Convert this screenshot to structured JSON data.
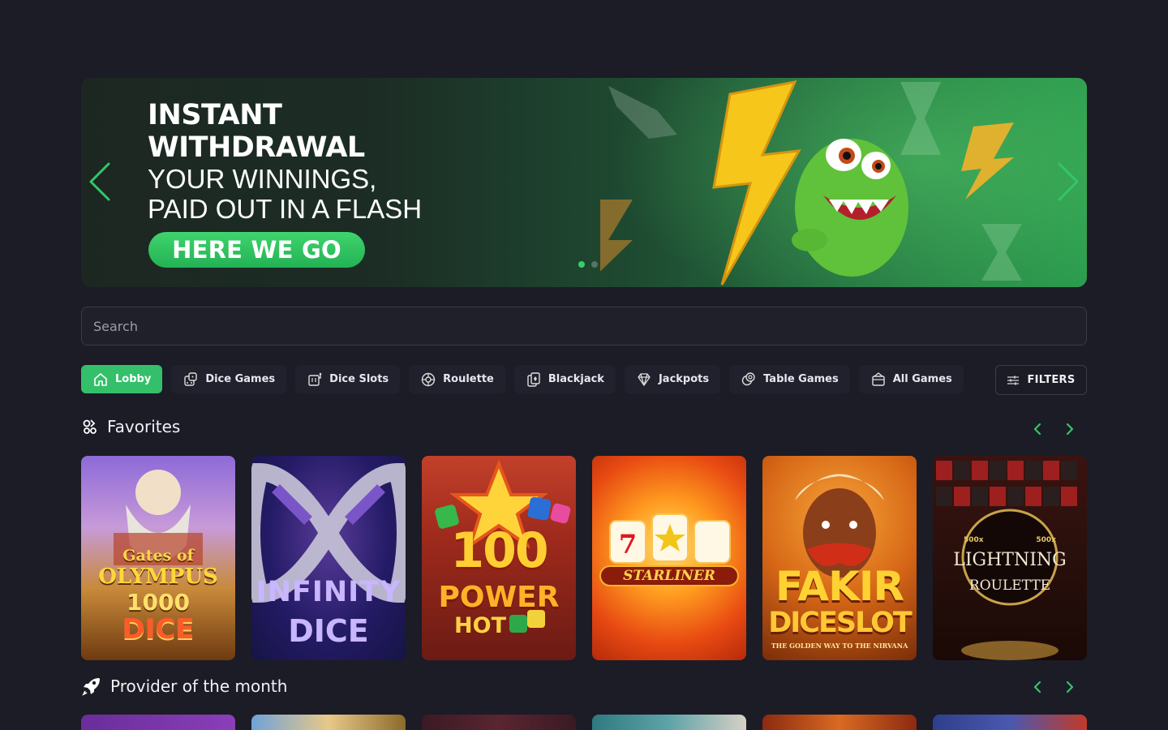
{
  "hero": {
    "line1": "INSTANT",
    "line2": "WITHDRAWAL",
    "line3": "YOUR WINNINGS,",
    "line4": "PAID OUT IN A FLASH",
    "cta": "HERE WE GO"
  },
  "search": {
    "placeholder": "Search"
  },
  "tabs": [
    {
      "label": "Lobby",
      "icon": "home-icon",
      "active": true
    },
    {
      "label": "Dice Games",
      "icon": "dice-icon"
    },
    {
      "label": "Dice Slots",
      "icon": "slot-machine-icon"
    },
    {
      "label": "Roulette",
      "icon": "roulette-icon"
    },
    {
      "label": "Blackjack",
      "icon": "cards-icon"
    },
    {
      "label": "Jackpots",
      "icon": "diamond-icon"
    },
    {
      "label": "Table Games",
      "icon": "chips-icon"
    },
    {
      "label": "All Games",
      "icon": "casino-icon"
    }
  ],
  "filters_label": "FILTERS",
  "favorites": {
    "title": "Favorites",
    "games": [
      {
        "line1": "Gates of",
        "line2": "OLYMPUS",
        "line3": "1000",
        "line4": "DICE"
      },
      {
        "line1": "INFINITY",
        "line2": "DICE"
      },
      {
        "line1": "100",
        "line2": "POWER",
        "line3": "HOT"
      },
      {
        "line1": "STARLINER"
      },
      {
        "line1": "FAKIR",
        "line2": "DICESLOT",
        "line3": "THE GOLDEN WAY TO THE NIRVANA"
      },
      {
        "line1": "LIGHTNING",
        "line2": "ROULETTE",
        "line3": "500x"
      }
    ]
  },
  "provider": {
    "title": "Provider of the month"
  },
  "colors": {
    "accent": "#34c06a",
    "background": "#1b1c26"
  }
}
